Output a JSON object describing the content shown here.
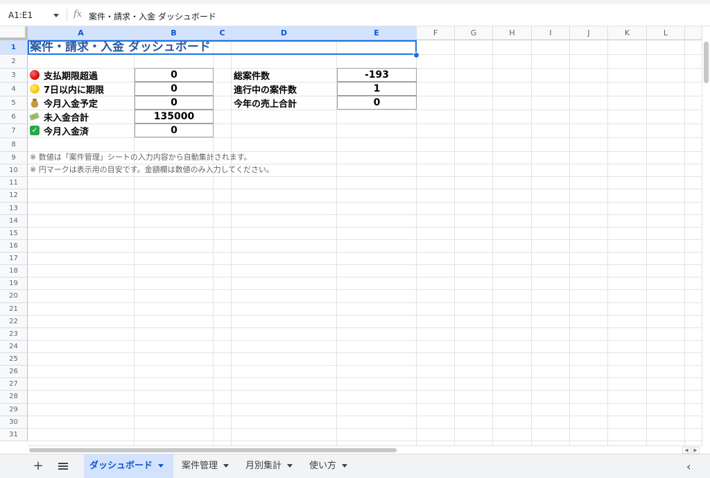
{
  "formula_bar": {
    "name_box": "A1:E1",
    "fx_label": "fx",
    "content": "案件・請求・入金 ダッシュボード"
  },
  "columns": [
    "A",
    "B",
    "C",
    "D",
    "E",
    "F",
    "G",
    "H",
    "I",
    "J",
    "K",
    "L"
  ],
  "rows": [
    "1",
    "2",
    "3",
    "4",
    "5",
    "6",
    "7",
    "8",
    "9",
    "10",
    "11",
    "12",
    "13",
    "14",
    "15",
    "16",
    "17",
    "18",
    "19",
    "20",
    "21",
    "22",
    "23",
    "24",
    "25",
    "26",
    "27",
    "28",
    "29",
    "30",
    "31"
  ],
  "sheet": {
    "title": "案件・請求・入金 ダッシュボード",
    "left_stats": [
      {
        "icon": "red-circle-icon",
        "label": "支払期限超過",
        "value": "0"
      },
      {
        "icon": "yellow-circle-icon",
        "label": "7日以内に期限",
        "value": "0"
      },
      {
        "icon": "money-bag-icon",
        "label": "今月入金予定",
        "value": "0"
      },
      {
        "icon": "flying-money-icon",
        "label": "未入金合計",
        "value": "135000"
      },
      {
        "icon": "check-mark-icon",
        "label": "今月入金済",
        "value": "0"
      }
    ],
    "right_stats": [
      {
        "label": "総案件数",
        "value": "-193"
      },
      {
        "label": "進行中の案件数",
        "value": "1"
      },
      {
        "label": "今年の売上合計",
        "value": "0"
      }
    ],
    "notes": [
      "※ 数値は「案件管理」シートの入力内容から自動集計されます。",
      "※ 円マークは表示用の目安です。金額欄は数値のみ入力してください。"
    ]
  },
  "tabs": {
    "add_label": "+",
    "items": [
      {
        "label": "ダッシュボード",
        "active": true
      },
      {
        "label": "案件管理",
        "active": false
      },
      {
        "label": "月別集計",
        "active": false
      },
      {
        "label": "使い方",
        "active": false
      }
    ],
    "nav_arrow": "‹"
  },
  "colors": {
    "title": "#2b5aa0",
    "selection": "#1a73e8",
    "header_selected": "#d3e3fd"
  }
}
